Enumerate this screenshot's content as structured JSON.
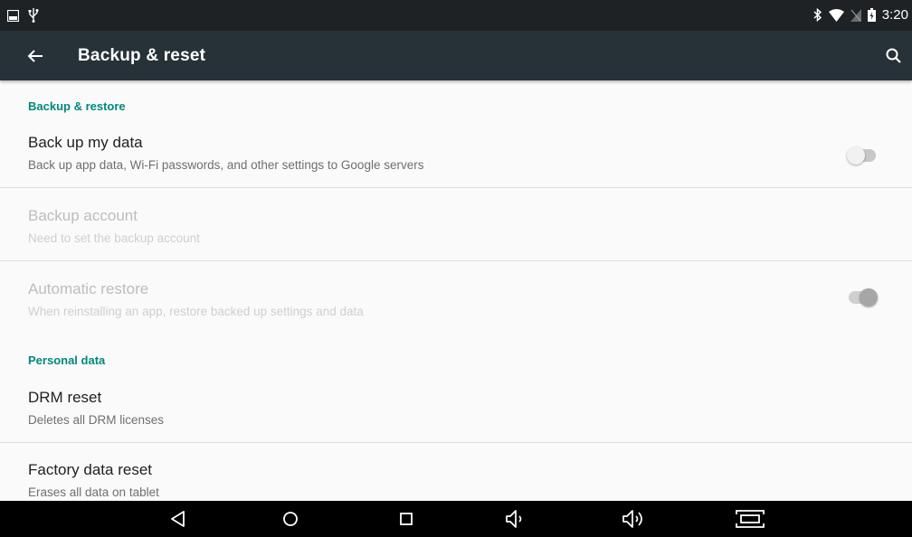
{
  "status_bar": {
    "time": "3:20",
    "icons_left": [
      "image-notification-icon",
      "usb-icon"
    ],
    "icons_right": [
      "bluetooth-icon",
      "wifi-icon",
      "no-sim-icon",
      "battery-charging-icon"
    ]
  },
  "app_bar": {
    "title": "Backup & reset",
    "color": "#263238"
  },
  "sections": {
    "backup_restore": "Backup & restore",
    "personal_data": "Personal data"
  },
  "prefs": {
    "backup_data": {
      "title": "Back up my data",
      "summary": "Back up app data, Wi-Fi passwords, and other settings to Google servers",
      "switch_on": false
    },
    "backup_account": {
      "title": "Backup account",
      "summary": "Need to set the backup account",
      "enabled": false
    },
    "auto_restore": {
      "title": "Automatic restore",
      "summary": "When reinstalling an app, restore backed up settings and data",
      "switch_on": true,
      "enabled": false
    },
    "drm_reset": {
      "title": "DRM reset",
      "summary": "Deletes all DRM licenses"
    },
    "factory_reset": {
      "title": "Factory data reset",
      "summary": "Erases all data on tablet"
    }
  },
  "nav_bar": {
    "buttons": [
      "back-icon",
      "home-icon",
      "recents-icon",
      "volume-down-icon",
      "volume-up-icon",
      "screenshot-icon"
    ]
  },
  "colors": {
    "accent": "#00897b",
    "status_bar": "#1e2225",
    "background": "#fafafa"
  }
}
